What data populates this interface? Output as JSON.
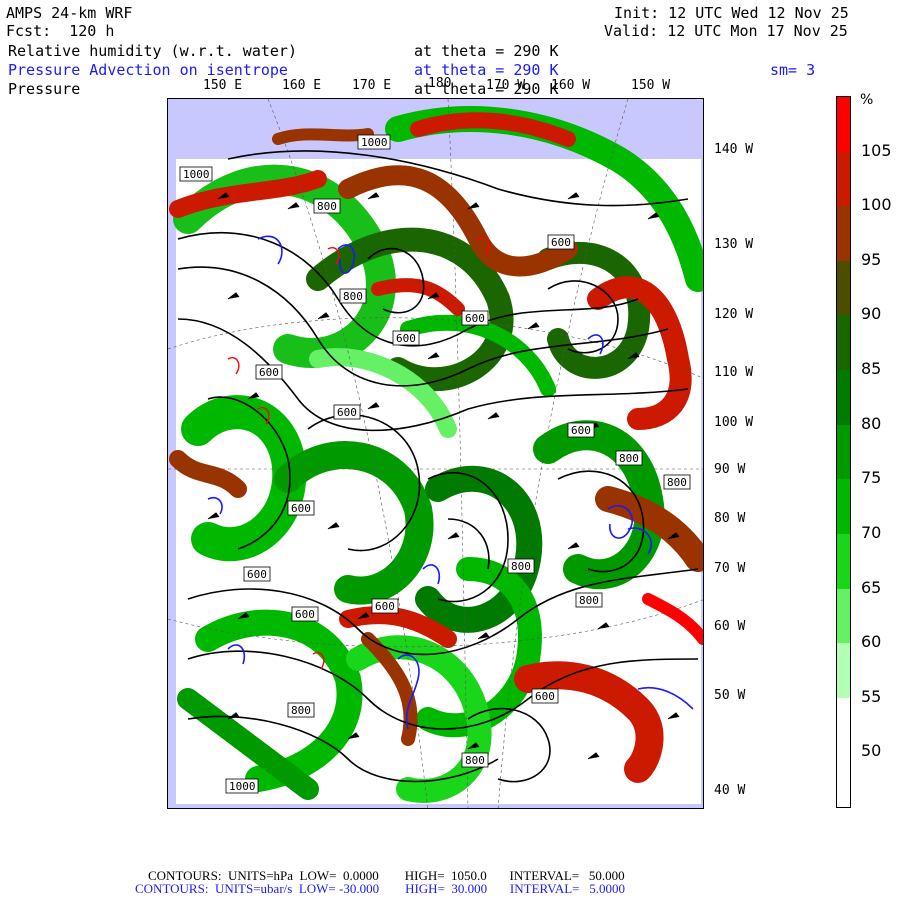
{
  "header": {
    "model": "AMPS 24-km WRF",
    "forecast": "Fcst:  120 h",
    "init": "Init: 12 UTC Wed 12 Nov 25",
    "valid": "Valid: 12 UTC Mon 17 Nov 25",
    "fields": [
      {
        "name": "Relative humidity (w.r.t. water)",
        "level": "at theta = 290 K",
        "color": "#000000"
      },
      {
        "name": "Pressure Advection on isentrope",
        "level": "at theta = 290 K",
        "color": "#1a1aff",
        "extra": "sm= 3"
      },
      {
        "name": "Pressure",
        "level": "at theta = 290 K",
        "color": "#000000"
      }
    ]
  },
  "map": {
    "longitude_labels_top": [
      "150 E",
      "160 E",
      "170 E",
      "180",
      "170 W",
      "160 W",
      "150 W"
    ],
    "longitude_labels_right": [
      "140 W",
      "130 W",
      "120 W",
      "110 W",
      "100 W",
      "90 W",
      "80 W",
      "70 W",
      "60 W",
      "50 W",
      "40 W"
    ],
    "pressure_contour_labels": [
      "1000",
      "1000",
      "800",
      "800",
      "600",
      "600",
      "600",
      "600",
      "600",
      "600",
      "600",
      "800",
      "800",
      "600",
      "600",
      "600",
      "800",
      "800",
      "600",
      "800",
      "1000",
      "800"
    ],
    "colors": {
      "ice_background": "#c8c8ff",
      "contour_black": "#000000",
      "contour_blue": "#1a1aff",
      "contour_red": "#ff0000"
    }
  },
  "colorbar": {
    "unit": "%",
    "labels": [
      "105",
      "100",
      "95",
      "90",
      "85",
      "80",
      "75",
      "70",
      "65",
      "60",
      "55",
      "50"
    ],
    "colors": [
      "#ff0000",
      "#cc1a00",
      "#993300",
      "#4d4d00",
      "#1a6600",
      "#007a00",
      "#009900",
      "#00b800",
      "#1ad61a",
      "#66f066",
      "#b3ffb3",
      "#ffffff",
      "#ffffff"
    ]
  },
  "footer": {
    "line1": "CONTOURS:  UNITS=hPa  LOW=  0.0000        HIGH=  1050.0       INTERVAL=   50.000",
    "line2": "CONTOURS:  UNITS=ubar/s  LOW= -30.000        HIGH=  30.000       INTERVAL=   5.0000"
  }
}
